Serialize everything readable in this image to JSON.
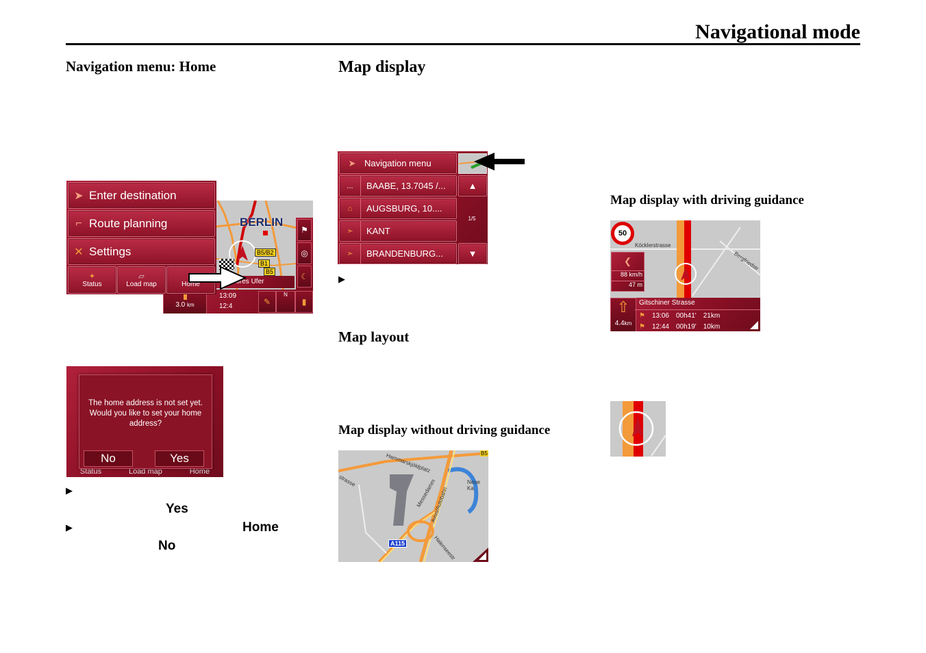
{
  "header": {
    "title": "Navigational mode"
  },
  "col1": {
    "heading": "Navigation menu: Home",
    "screen1": {
      "menu_items": [
        {
          "label": "Enter destination",
          "icon": "navigation-arrow-icon"
        },
        {
          "label": "Route planning",
          "icon": "route-icon"
        },
        {
          "label": "Settings",
          "icon": "tools-icon"
        }
      ],
      "bottom_buttons": [
        {
          "label": "Status",
          "icon": "satellite-icon"
        },
        {
          "label": "Load map",
          "icon": "map-icon"
        },
        {
          "label": "Home",
          "icon": "house-icon"
        }
      ],
      "map": {
        "city_label": "BERLIN",
        "road_badges": [
          "B5/B2",
          "B1",
          "B5"
        ],
        "street": "...ores Ufer",
        "time": "13:09",
        "time2": "12:4",
        "distance": "3.0",
        "distance_unit": "km",
        "compass": "N"
      }
    },
    "screen2": {
      "dialog_text": "The home address is not set yet. Would you like to set your home address?",
      "no_label": "No",
      "yes_label": "Yes",
      "behind_buttons": [
        "Status",
        "Load map",
        "Home"
      ]
    },
    "bullets": [
      {
        "bold": "Yes"
      },
      {
        "bold1": "Home",
        "bold2": "No"
      }
    ]
  },
  "col2": {
    "heading": "Map display",
    "screen": {
      "nav_menu_label": "Navigation menu",
      "items": [
        {
          "icon": "ellipsis",
          "label": "BAABE, 13.7045 /..."
        },
        {
          "icon": "house-icon",
          "label": "AUGSBURG, 10...."
        },
        {
          "icon": "flag-icon",
          "label": "KANT"
        },
        {
          "icon": "flag-icon",
          "label": "BRANDENBURG..."
        }
      ],
      "page_indicator": "1/5",
      "ellipsis": "..."
    },
    "layout_heading": "Map layout",
    "without_heading": "Map display without driving guidance",
    "map_without": {
      "streets": [
        "Hammarskjöldplatz",
        "Messedamm",
        "Avus/Autobahn",
        "strasse",
        "Neue Ka",
        "Halenseestr"
      ],
      "road_badge": "A115",
      "badge2": "B5"
    }
  },
  "col3": {
    "with_heading": "Map display with driving guidance",
    "map_with": {
      "speed_limit": "50",
      "cross_street": "Köcklerstrasse",
      "side_street": "Bergfriedstr",
      "speed": "88 km/h",
      "distance_to_turn": "47 m",
      "next_distance": "4.4",
      "next_distance_unit": "km",
      "street": "Gitschiner Strasse",
      "rows": [
        {
          "time": "13:06",
          "duration": "00h41'",
          "distance": "21km"
        },
        {
          "time": "12:44",
          "duration": "00h19'",
          "distance": "10km"
        }
      ]
    }
  },
  "colors": {
    "brand_red": "#9b1a30",
    "road_orange": "#f39a3a",
    "route_red": "#e00000"
  }
}
